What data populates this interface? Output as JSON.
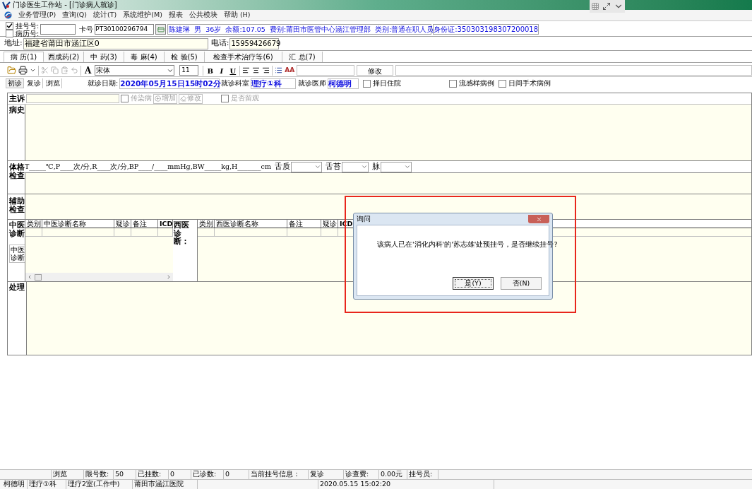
{
  "window": {
    "title": "门诊医生工作站 - [门诊病人就诊]"
  },
  "menu": [
    "业务管理(P)",
    "查询(Q)",
    "统计(T)",
    "系统维护(M)",
    "报表",
    "公共模块",
    "帮助 (H)"
  ],
  "patient": {
    "lookup": [
      {
        "label": "挂号号:",
        "checked": true
      },
      {
        "label": "病历号:",
        "checked": false
      }
    ],
    "card_label": "卡号",
    "card_no": "PT30100296794",
    "info": "陈建琳  男  36岁  余额:107.05  费别:莆田市医管中心涵江管理部  类别:普通在职人员",
    "id_card": "身份证:350303198307200018",
    "address_label": "地址:",
    "address": "福建省莆田市涵江区0",
    "phone_label": "电话:",
    "phone": "15959426679"
  },
  "tabs": [
    {
      "label": "病 历(1)",
      "selected": true
    },
    {
      "label": "西成药(2)",
      "selected": false
    },
    {
      "label": "中 药(3)",
      "selected": false
    },
    {
      "label": "毒 麻(4)",
      "selected": false
    },
    {
      "label": "检 验(5)",
      "selected": false
    },
    {
      "label": "检查手术治疗等(6)",
      "selected": false
    },
    {
      "label": "汇 总(7)",
      "selected": false
    }
  ],
  "toolbar": {
    "font_label": "A",
    "font": "宋体",
    "size": "11",
    "styles": [
      "B",
      "I",
      "U"
    ],
    "color_label": "AA",
    "edit_button": "修改"
  },
  "visit": {
    "modes": [
      {
        "label": "初诊",
        "selected": true
      },
      {
        "label": "复诊",
        "selected": false
      },
      {
        "label": "浏览",
        "selected": false
      }
    ],
    "date_label": "就诊日期:",
    "date": "2020年05月15日15时02分",
    "dept_label": "就诊科室",
    "dept": "理疗①科",
    "doctor_label": "就诊医师",
    "doctor": "柯德明",
    "options": [
      {
        "label": "择日住院",
        "checked": false
      },
      {
        "label": "流感样病例",
        "checked": false
      },
      {
        "label": "日间手术病例",
        "checked": false
      }
    ]
  },
  "record": {
    "complaint_label": "主诉",
    "infectious": {
      "label": "传染病",
      "checked": false
    },
    "add_button": "增加",
    "edit_button": "修改",
    "observation": {
      "label": "是否留观",
      "checked": false
    },
    "history_label": "病史",
    "exam_label": "体格检查",
    "vitals": "T_____℃,P____次/分,R____次/分,BP____/____mmHg,BW_____kg,H_______cm",
    "selects": [
      "舌质",
      "舌苔",
      "脉"
    ],
    "aux_label": "辅助检查",
    "tcm_label": "中医诊断",
    "tcm_columns": [
      "类别",
      "中医诊断名称",
      "疑诊",
      "备注",
      "ICD"
    ],
    "tcm_tab": "中医诊断",
    "western_label": "西医诊断：",
    "western_columns": [
      "类别",
      "西医诊断名称",
      "备注",
      "疑诊",
      "ICD"
    ],
    "treatment_label": "处理"
  },
  "dialog": {
    "title": "询问",
    "message": "该病人已在'消化内科'的'苏志雄'处预挂号，是否继续挂号?",
    "buttons": [
      {
        "label": "是(Y)",
        "selected": true
      },
      {
        "label": "否(N)",
        "selected": false
      }
    ]
  },
  "status_bar": {
    "row1": [
      "浏览",
      "限号数:",
      "50",
      "已挂数:",
      "0",
      "已诊数:",
      "0",
      "当前挂号信息：",
      "复诊",
      "诊查费:",
      "0.00元",
      "挂号员:"
    ],
    "row2": [
      "柯德明",
      "理疗①科",
      "理疗2室(工作中)",
      "莆田市涵江医院",
      "2020.05.15 15:02:20"
    ]
  }
}
